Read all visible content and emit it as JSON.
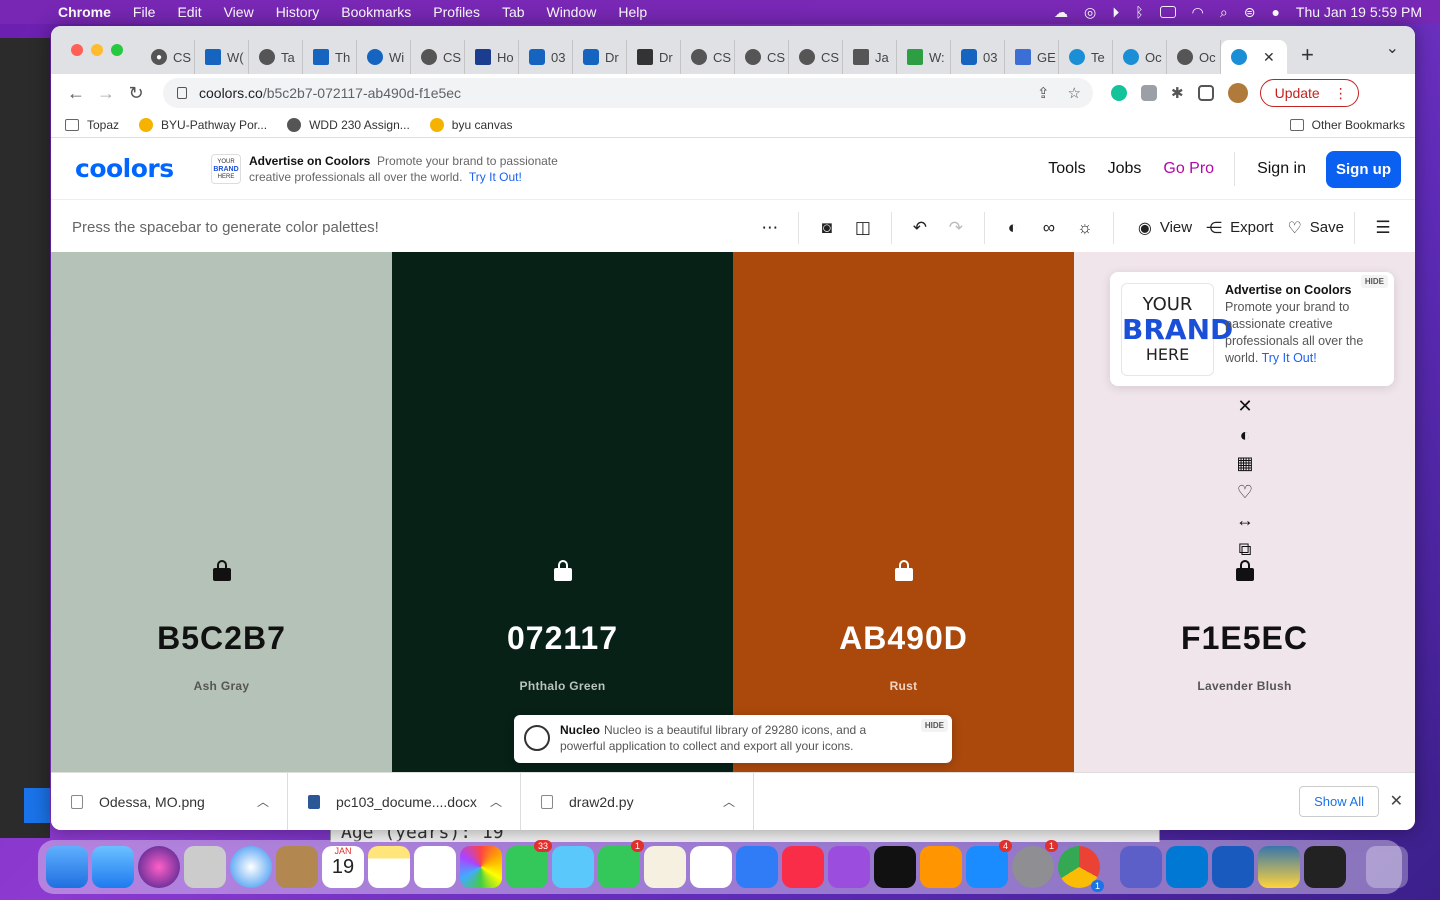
{
  "menubar": {
    "app": "Chrome",
    "items": [
      "File",
      "Edit",
      "View",
      "History",
      "Bookmarks",
      "Profiles",
      "Tab",
      "Window",
      "Help"
    ],
    "clock": "Thu Jan 19  5:59 PM"
  },
  "browser": {
    "tabs": [
      "CS",
      "W(",
      "Ta",
      "Th",
      "Wi",
      "CS",
      "Ho",
      "03",
      "Dr",
      "Dr",
      "CS",
      "CS",
      "CS",
      "Ja",
      "W:",
      "03",
      "GE",
      "Te",
      "Oc",
      "Oc",
      ""
    ],
    "url_host": "coolors.co",
    "url_path": "/b5c2b7-072117-ab490d-f1e5ec",
    "update_label": "Update",
    "bookmarks": [
      "Topaz",
      "BYU-Pathway Por...",
      "WDD 230 Assign...",
      "byu canvas"
    ],
    "other_bookmarks": "Other Bookmarks"
  },
  "site": {
    "logo": "coolors",
    "ad_small": {
      "brand": "YOUR BRAND HERE",
      "title": "Advertise on Coolors",
      "text": "Promote your brand to passionate creative professionals all over the world.",
      "link": "Try It Out!"
    },
    "nav": {
      "tools": "Tools",
      "jobs": "Jobs",
      "gopro": "Go Pro",
      "signin": "Sign in",
      "signup": "Sign up"
    },
    "hint": "Press the spacebar to generate color palettes!",
    "toolbar": {
      "view": "View",
      "export": "Export",
      "save": "Save"
    }
  },
  "palette": [
    {
      "hex": "B5C2B7",
      "name": "Ash Gray",
      "color": "#B5C2B7",
      "text": "#111111",
      "sub": "#555555"
    },
    {
      "hex": "072117",
      "name": "Phthalo Green",
      "color": "#072117",
      "text": "#ffffff",
      "sub": "#b9c3bf"
    },
    {
      "hex": "AB490D",
      "name": "Rust",
      "color": "#AB490D",
      "text": "#ffffff",
      "sub": "#f0d3c2"
    },
    {
      "hex": "F1E5EC",
      "name": "Lavender Blush",
      "color": "#F1E5EC",
      "text": "#111111",
      "sub": "#555555"
    }
  ],
  "ad_card": {
    "brand_l1": "YOUR",
    "brand_l2": "BRAND",
    "brand_l3": "HERE",
    "title": "Advertise on Coolors",
    "text": "Promote your brand to passionate creative professionals all over the world.",
    "link": "Try It Out!",
    "hide": "HIDE"
  },
  "nucleo": {
    "title": "Nucleo",
    "text": "Nucleo is a beautiful library of 29280 icons, and a powerful application to collect and export all your icons.",
    "hide": "HIDE"
  },
  "downloads": {
    "files": [
      "Odessa, MO.png",
      "pc103_docume....docx",
      "draw2d.py"
    ],
    "show_all": "Show All"
  },
  "background_text": "Age (years): 19",
  "dock": {
    "calendar_month": "JAN",
    "calendar_day": "19",
    "messages_badge": "33",
    "facetime_badge": "1",
    "appstore_badge": "4",
    "settings_badge": "1",
    "chrome_badge": "1"
  }
}
